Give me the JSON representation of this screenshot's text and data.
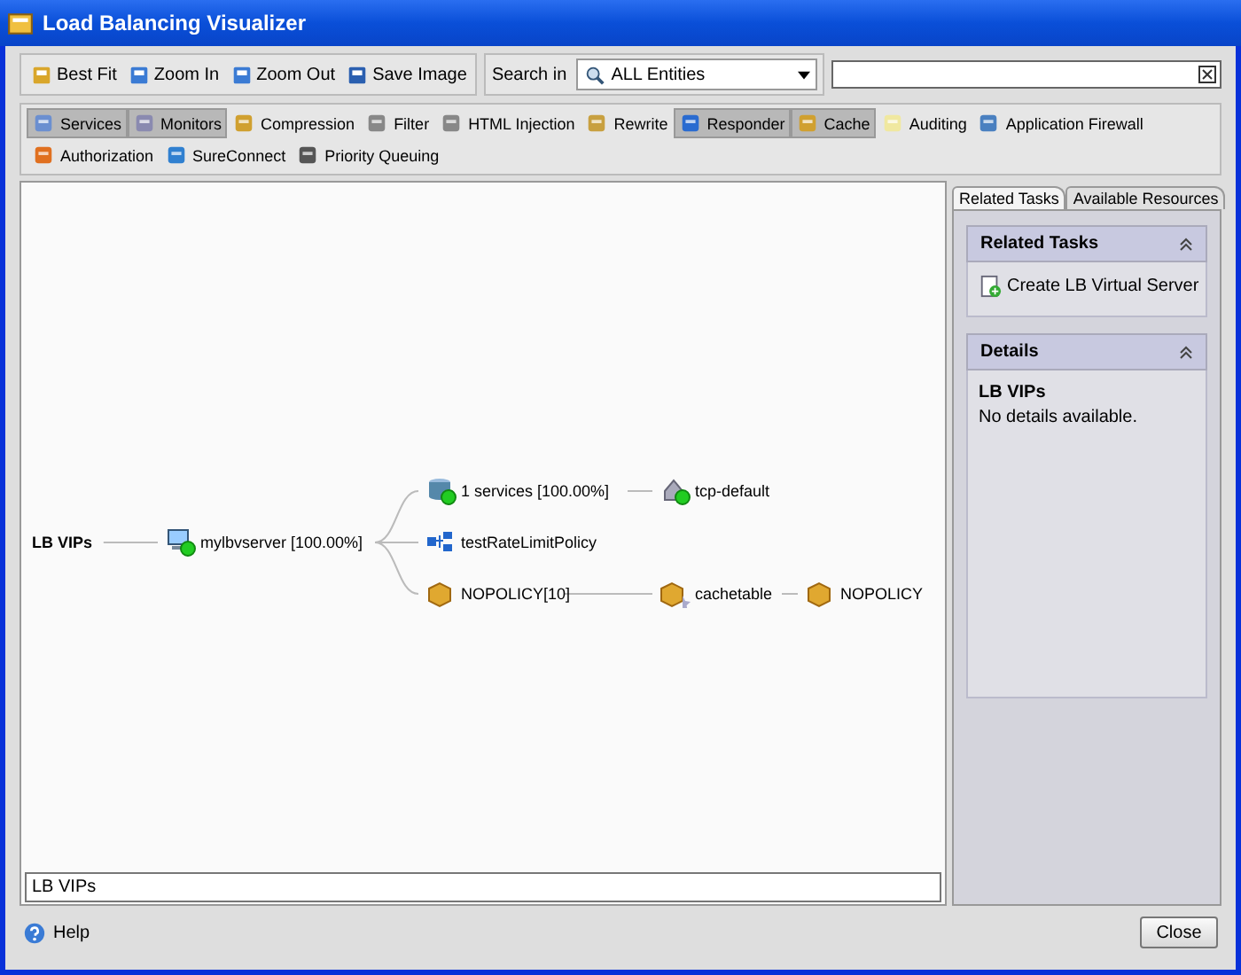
{
  "window": {
    "title": "Load Balancing Visualizer"
  },
  "toolbar": {
    "buttons": [
      {
        "label": "Best Fit"
      },
      {
        "label": "Zoom In"
      },
      {
        "label": "Zoom Out"
      },
      {
        "label": "Save Image"
      }
    ],
    "search_label": "Search in",
    "scope": "ALL Entities"
  },
  "filters": [
    {
      "label": "Services",
      "selected": true
    },
    {
      "label": "Monitors",
      "selected": true
    },
    {
      "label": "Compression",
      "selected": false
    },
    {
      "label": "Filter",
      "selected": false
    },
    {
      "label": "HTML Injection",
      "selected": false
    },
    {
      "label": "Rewrite",
      "selected": false
    },
    {
      "label": "Responder",
      "selected": true
    },
    {
      "label": "Cache",
      "selected": true
    },
    {
      "label": "Auditing",
      "selected": false
    },
    {
      "label": "Application Firewall",
      "selected": false
    },
    {
      "label": "Authorization",
      "selected": false
    },
    {
      "label": "SureConnect",
      "selected": false
    },
    {
      "label": "Priority Queuing",
      "selected": false
    }
  ],
  "graph": {
    "label": "LB VIPs",
    "kind": "root",
    "children": [
      {
        "label": "mylbvserver [100.00%]",
        "kind": "vserver",
        "up": true,
        "children": [
          {
            "label": "1 services [100.00%]",
            "kind": "services",
            "up": true,
            "children": [
              {
                "label": "tcp-default",
                "kind": "monitor",
                "up": true
              }
            ]
          },
          {
            "label": "testRateLimitPolicy",
            "kind": "policy",
            "up": false
          },
          {
            "label": "NOPOLICY[10]",
            "kind": "cache",
            "up": false,
            "children": [
              {
                "label": "cachetable",
                "kind": "cachetable",
                "up": false,
                "children": [
                  {
                    "label": "NOPOLICY",
                    "kind": "cache",
                    "up": false
                  }
                ]
              }
            ]
          }
        ]
      }
    ]
  },
  "status_field": "LB VIPs",
  "side_tabs": [
    {
      "label": "Related Tasks",
      "selected": true
    },
    {
      "label": "Available Resources",
      "selected": false
    }
  ],
  "related_tasks": {
    "title": "Related Tasks",
    "items": [
      "Create LB Virtual Server"
    ]
  },
  "details": {
    "title": "Details",
    "heading": "LB VIPs",
    "text": "No details available."
  },
  "footer": {
    "help": "Help",
    "close": "Close"
  }
}
